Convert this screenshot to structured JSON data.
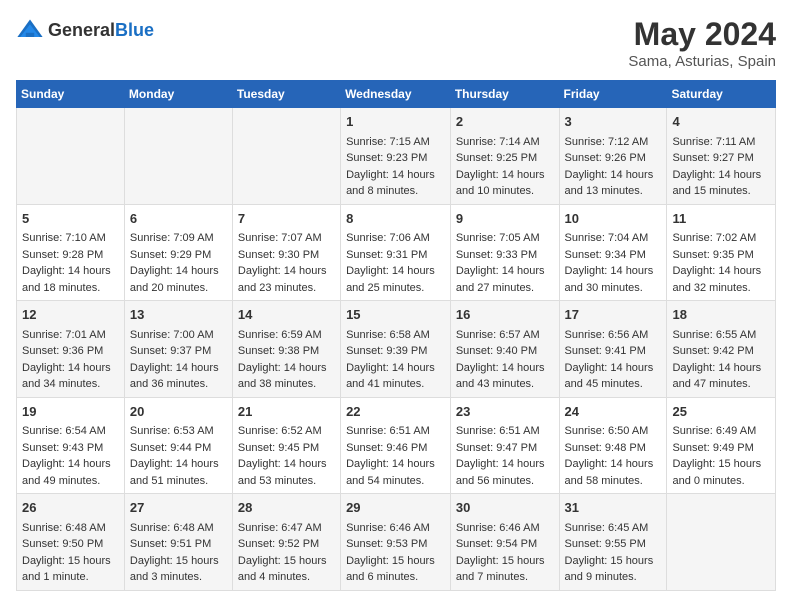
{
  "header": {
    "logo_general": "General",
    "logo_blue": "Blue",
    "title": "May 2024",
    "subtitle": "Sama, Asturias, Spain"
  },
  "days_of_week": [
    "Sunday",
    "Monday",
    "Tuesday",
    "Wednesday",
    "Thursday",
    "Friday",
    "Saturday"
  ],
  "weeks": [
    {
      "cells": [
        {
          "day": "",
          "content": ""
        },
        {
          "day": "",
          "content": ""
        },
        {
          "day": "",
          "content": ""
        },
        {
          "day": "1",
          "content": "Sunrise: 7:15 AM\nSunset: 9:23 PM\nDaylight: 14 hours\nand 8 minutes."
        },
        {
          "day": "2",
          "content": "Sunrise: 7:14 AM\nSunset: 9:25 PM\nDaylight: 14 hours\nand 10 minutes."
        },
        {
          "day": "3",
          "content": "Sunrise: 7:12 AM\nSunset: 9:26 PM\nDaylight: 14 hours\nand 13 minutes."
        },
        {
          "day": "4",
          "content": "Sunrise: 7:11 AM\nSunset: 9:27 PM\nDaylight: 14 hours\nand 15 minutes."
        }
      ]
    },
    {
      "cells": [
        {
          "day": "5",
          "content": "Sunrise: 7:10 AM\nSunset: 9:28 PM\nDaylight: 14 hours\nand 18 minutes."
        },
        {
          "day": "6",
          "content": "Sunrise: 7:09 AM\nSunset: 9:29 PM\nDaylight: 14 hours\nand 20 minutes."
        },
        {
          "day": "7",
          "content": "Sunrise: 7:07 AM\nSunset: 9:30 PM\nDaylight: 14 hours\nand 23 minutes."
        },
        {
          "day": "8",
          "content": "Sunrise: 7:06 AM\nSunset: 9:31 PM\nDaylight: 14 hours\nand 25 minutes."
        },
        {
          "day": "9",
          "content": "Sunrise: 7:05 AM\nSunset: 9:33 PM\nDaylight: 14 hours\nand 27 minutes."
        },
        {
          "day": "10",
          "content": "Sunrise: 7:04 AM\nSunset: 9:34 PM\nDaylight: 14 hours\nand 30 minutes."
        },
        {
          "day": "11",
          "content": "Sunrise: 7:02 AM\nSunset: 9:35 PM\nDaylight: 14 hours\nand 32 minutes."
        }
      ]
    },
    {
      "cells": [
        {
          "day": "12",
          "content": "Sunrise: 7:01 AM\nSunset: 9:36 PM\nDaylight: 14 hours\nand 34 minutes."
        },
        {
          "day": "13",
          "content": "Sunrise: 7:00 AM\nSunset: 9:37 PM\nDaylight: 14 hours\nand 36 minutes."
        },
        {
          "day": "14",
          "content": "Sunrise: 6:59 AM\nSunset: 9:38 PM\nDaylight: 14 hours\nand 38 minutes."
        },
        {
          "day": "15",
          "content": "Sunrise: 6:58 AM\nSunset: 9:39 PM\nDaylight: 14 hours\nand 41 minutes."
        },
        {
          "day": "16",
          "content": "Sunrise: 6:57 AM\nSunset: 9:40 PM\nDaylight: 14 hours\nand 43 minutes."
        },
        {
          "day": "17",
          "content": "Sunrise: 6:56 AM\nSunset: 9:41 PM\nDaylight: 14 hours\nand 45 minutes."
        },
        {
          "day": "18",
          "content": "Sunrise: 6:55 AM\nSunset: 9:42 PM\nDaylight: 14 hours\nand 47 minutes."
        }
      ]
    },
    {
      "cells": [
        {
          "day": "19",
          "content": "Sunrise: 6:54 AM\nSunset: 9:43 PM\nDaylight: 14 hours\nand 49 minutes."
        },
        {
          "day": "20",
          "content": "Sunrise: 6:53 AM\nSunset: 9:44 PM\nDaylight: 14 hours\nand 51 minutes."
        },
        {
          "day": "21",
          "content": "Sunrise: 6:52 AM\nSunset: 9:45 PM\nDaylight: 14 hours\nand 53 minutes."
        },
        {
          "day": "22",
          "content": "Sunrise: 6:51 AM\nSunset: 9:46 PM\nDaylight: 14 hours\nand 54 minutes."
        },
        {
          "day": "23",
          "content": "Sunrise: 6:51 AM\nSunset: 9:47 PM\nDaylight: 14 hours\nand 56 minutes."
        },
        {
          "day": "24",
          "content": "Sunrise: 6:50 AM\nSunset: 9:48 PM\nDaylight: 14 hours\nand 58 minutes."
        },
        {
          "day": "25",
          "content": "Sunrise: 6:49 AM\nSunset: 9:49 PM\nDaylight: 15 hours\nand 0 minutes."
        }
      ]
    },
    {
      "cells": [
        {
          "day": "26",
          "content": "Sunrise: 6:48 AM\nSunset: 9:50 PM\nDaylight: 15 hours\nand 1 minute."
        },
        {
          "day": "27",
          "content": "Sunrise: 6:48 AM\nSunset: 9:51 PM\nDaylight: 15 hours\nand 3 minutes."
        },
        {
          "day": "28",
          "content": "Sunrise: 6:47 AM\nSunset: 9:52 PM\nDaylight: 15 hours\nand 4 minutes."
        },
        {
          "day": "29",
          "content": "Sunrise: 6:46 AM\nSunset: 9:53 PM\nDaylight: 15 hours\nand 6 minutes."
        },
        {
          "day": "30",
          "content": "Sunrise: 6:46 AM\nSunset: 9:54 PM\nDaylight: 15 hours\nand 7 minutes."
        },
        {
          "day": "31",
          "content": "Sunrise: 6:45 AM\nSunset: 9:55 PM\nDaylight: 15 hours\nand 9 minutes."
        },
        {
          "day": "",
          "content": ""
        }
      ]
    }
  ]
}
